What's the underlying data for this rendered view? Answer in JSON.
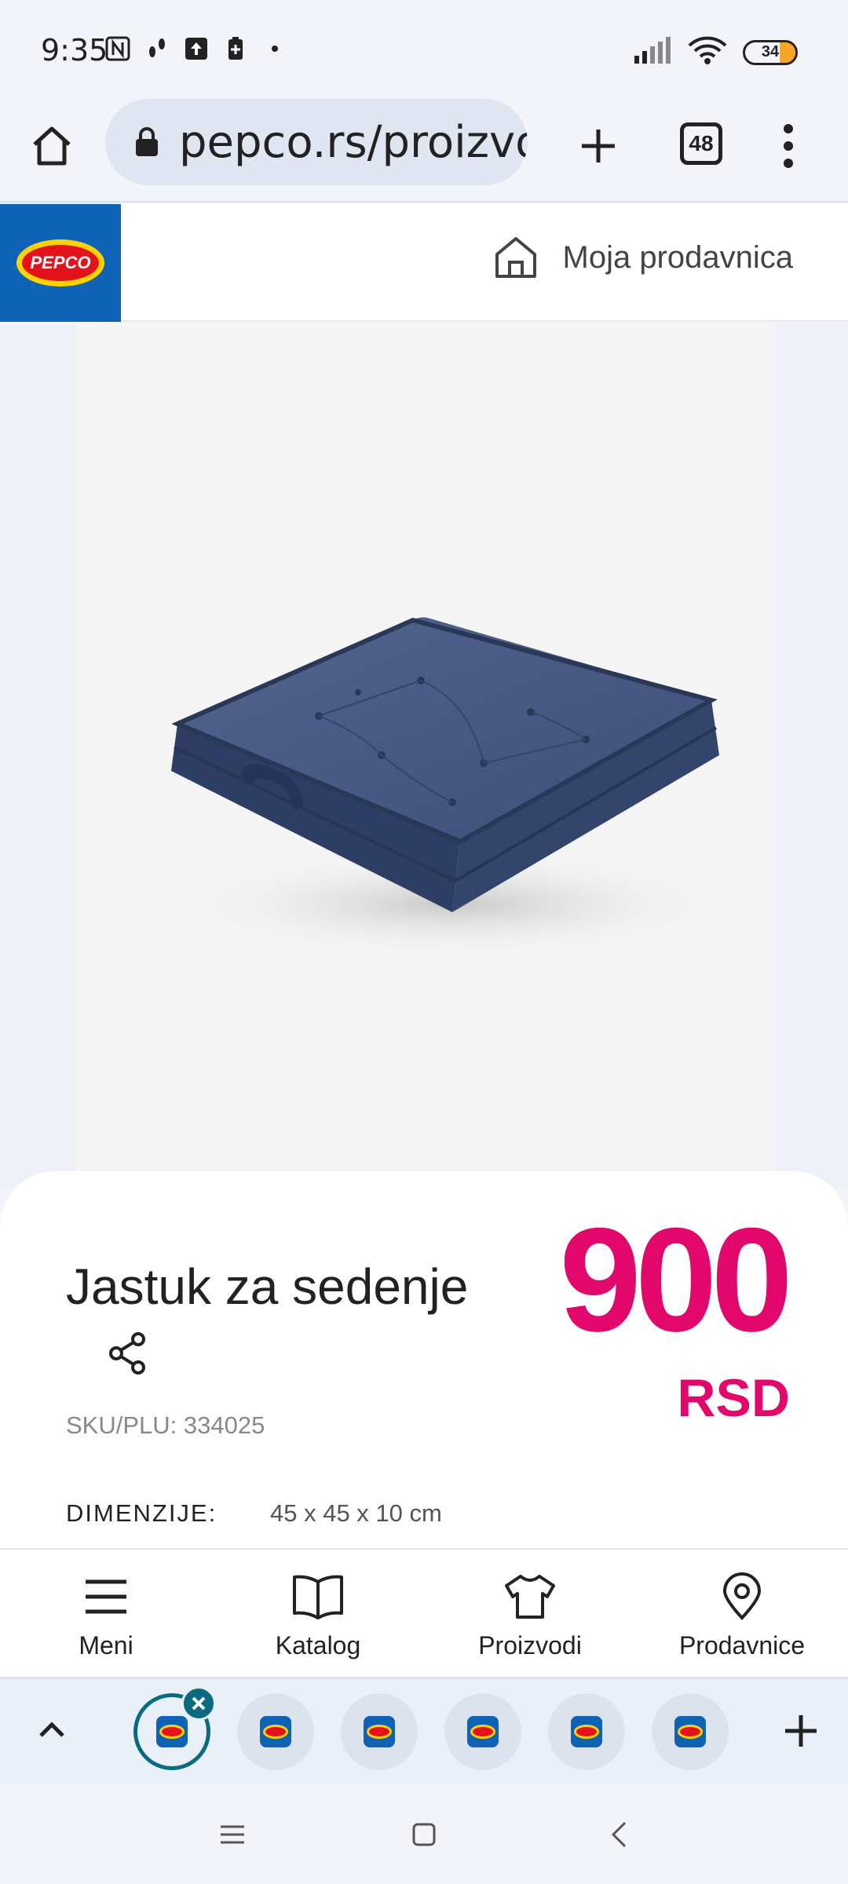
{
  "status_bar": {
    "time": "9:35",
    "battery": "34",
    "icons_left": [
      "nfc-icon",
      "footsteps-icon",
      "upload-icon",
      "battery-saver-icon",
      "dot-icon"
    ],
    "icons_right": [
      "signal-icon",
      "wifi-icon",
      "battery-icon"
    ]
  },
  "browser": {
    "url": "pepco.rs/proizvo",
    "tab_count": "48"
  },
  "header": {
    "logo_text": "PEPCO",
    "store_label": "Moja prodavnica"
  },
  "product": {
    "title": "Jastuk za sedenje",
    "price": "900",
    "currency": "RSD",
    "sku": "SKU/PLU: 334025",
    "dimensions_label": "DIMENZIJE:",
    "dimensions_value": "45 x 45 x 10 cm"
  },
  "bottom_nav": {
    "items": [
      {
        "label": "Meni",
        "icon": "hamburger-menu-icon"
      },
      {
        "label": "Katalog",
        "icon": "book-icon"
      },
      {
        "label": "Proizvodi",
        "icon": "tshirt-icon"
      },
      {
        "label": "Prodavnice",
        "icon": "location-pin-icon"
      }
    ]
  },
  "colors": {
    "brand_blue": "#0e63b5",
    "price_pink": "#e2076a",
    "tab_accent": "#0a6a80"
  }
}
